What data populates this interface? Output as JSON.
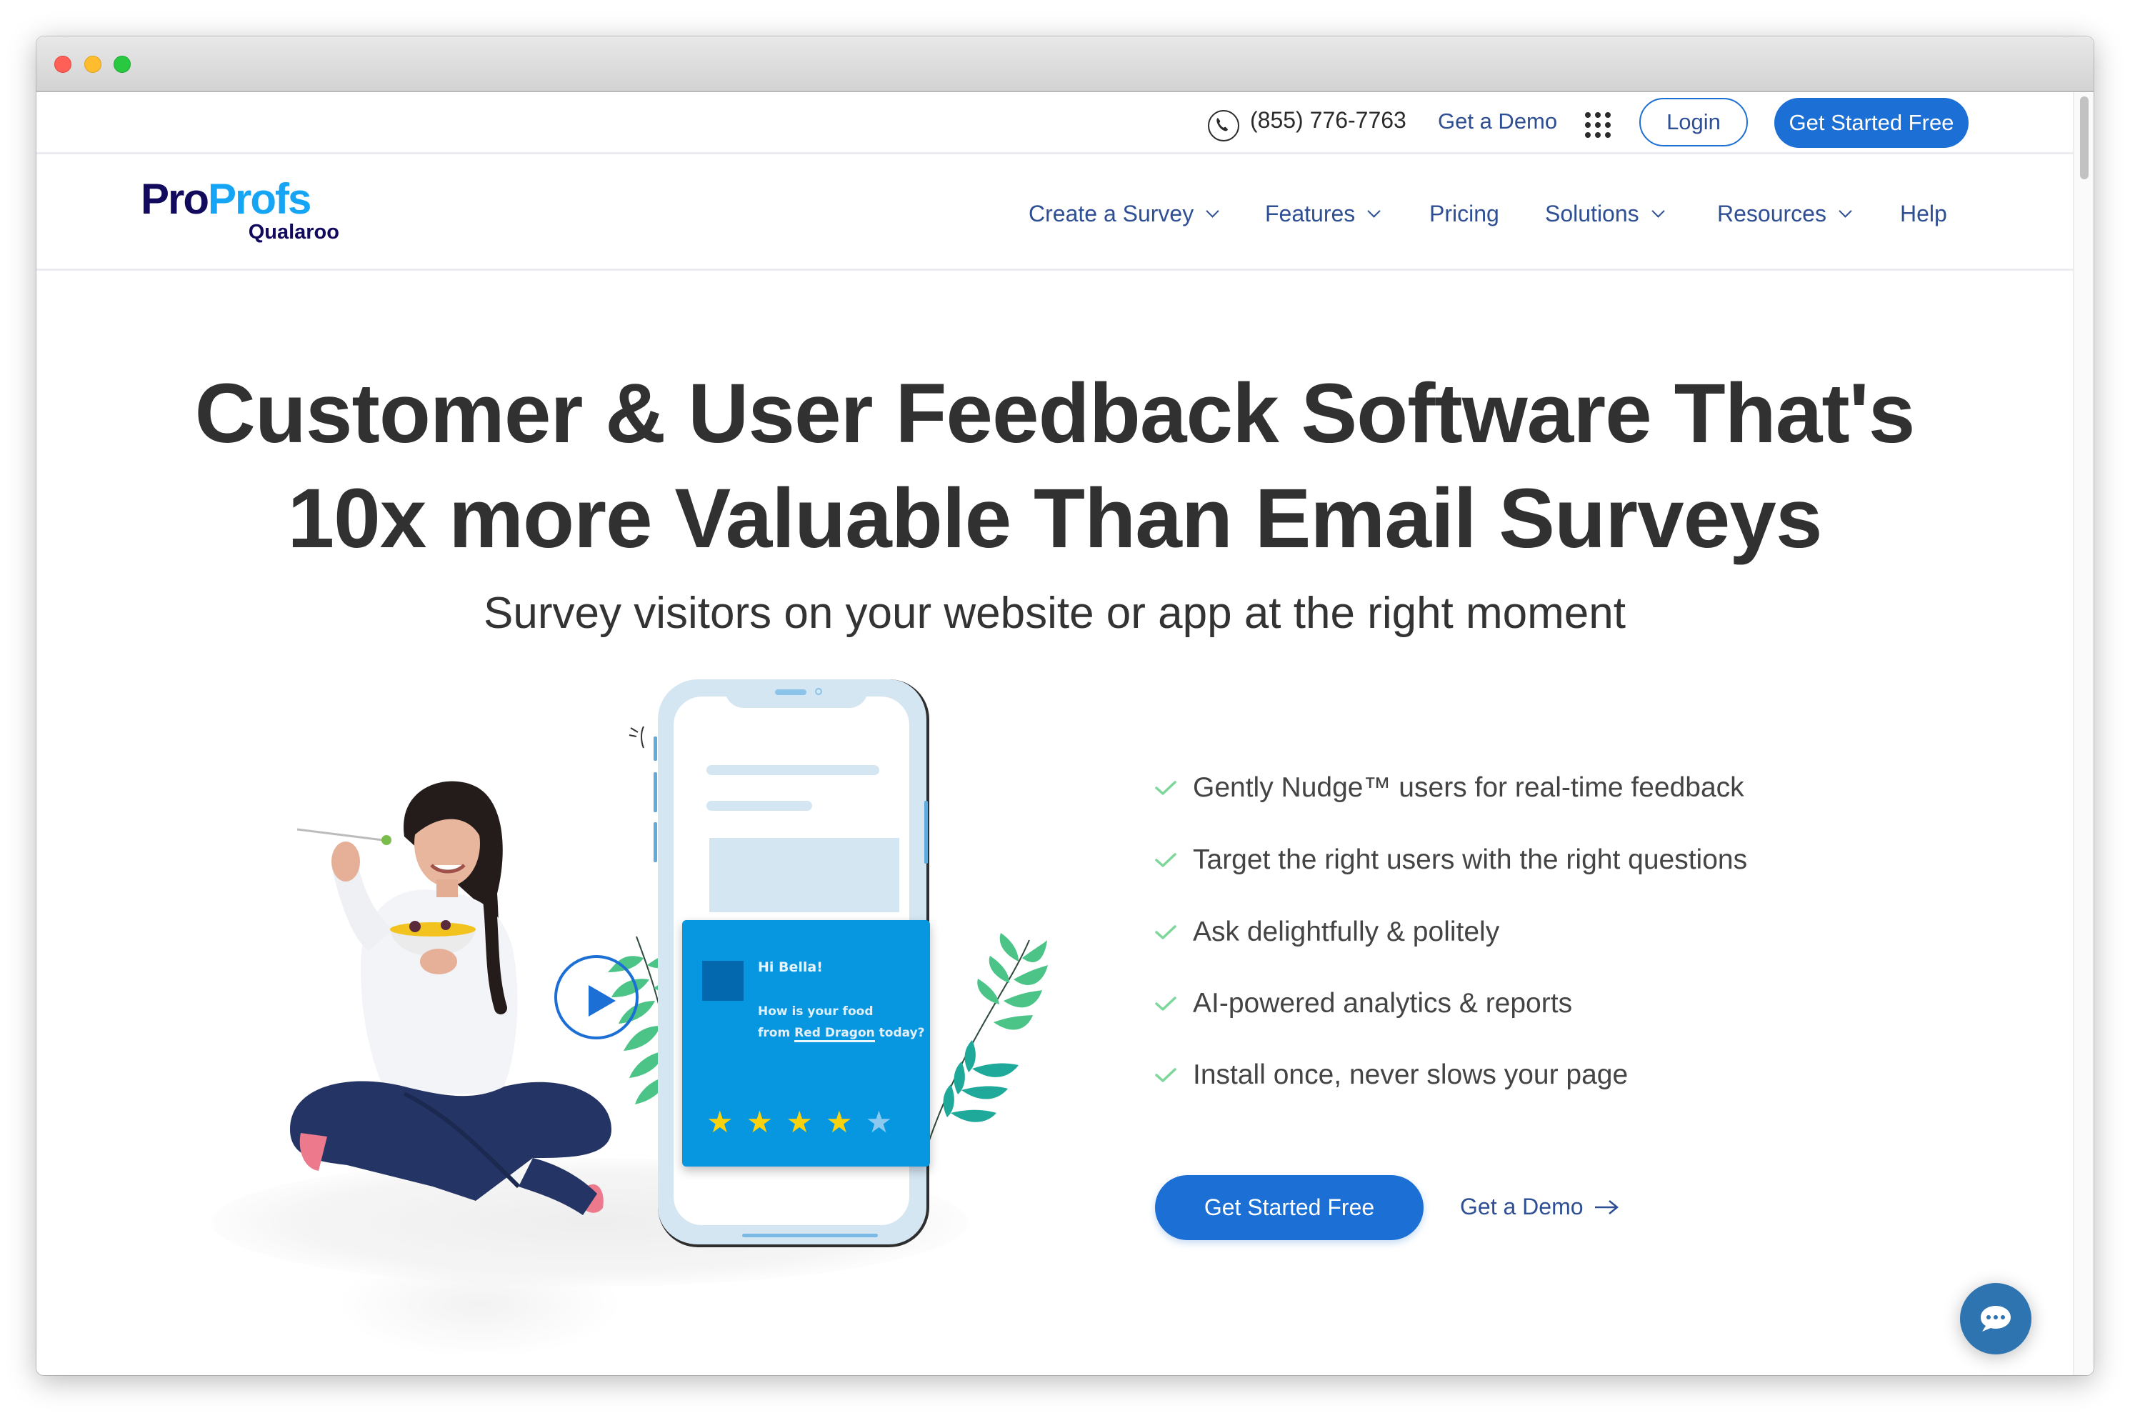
{
  "window": {
    "controls": [
      "close",
      "minimize",
      "maximize"
    ]
  },
  "topbar": {
    "phone_icon": "phone-icon",
    "phone": "(855) 776-7763",
    "demo_link": "Get a Demo",
    "apps_icon": "grid-icon",
    "login": "Login",
    "get_started": "Get Started Free"
  },
  "logo": {
    "pro": "Pro",
    "profs": "Profs",
    "sub": "Qualaroo"
  },
  "nav": {
    "items": [
      {
        "label": "Create a Survey",
        "has_dropdown": true
      },
      {
        "label": "Features",
        "has_dropdown": true
      },
      {
        "label": "Pricing",
        "has_dropdown": false
      },
      {
        "label": "Solutions",
        "has_dropdown": true
      },
      {
        "label": "Resources",
        "has_dropdown": true
      },
      {
        "label": "Help",
        "has_dropdown": false
      }
    ]
  },
  "hero": {
    "headline_line1": "Customer & User Feedback Software That's",
    "headline_line2": "10x more Valuable Than Email Surveys",
    "subheadline": "Survey visitors on your website or app at the right moment"
  },
  "illustration": {
    "popup_greeting": "Hi Bella!",
    "popup_question_line1": "How is your food",
    "popup_question_prefix": "from",
    "popup_question_highlight": "Red Dragon",
    "popup_question_suffix": "today?",
    "rating_value": 4,
    "rating_max": 5,
    "play_icon": "play-icon"
  },
  "features": [
    "Gently Nudge™ users for real-time feedback",
    "Target the right users with the right questions",
    "Ask delightfully & politely",
    "AI-powered analytics & reports",
    "Install once, never slows your page"
  ],
  "cta": {
    "primary": "Get Started Free",
    "secondary": "Get a Demo",
    "secondary_icon": "arrow-right-icon"
  },
  "chat": {
    "icon": "chat-bubble-icon"
  },
  "colors": {
    "brand_blue": "#1c6fd4",
    "nav_text": "#2f4f95",
    "logo_navy": "#120a5c",
    "logo_light_blue": "#16a4f5",
    "check_green": "#7dd69a",
    "chat_blue": "#2e74b0",
    "popup_blue": "#0796e0"
  }
}
